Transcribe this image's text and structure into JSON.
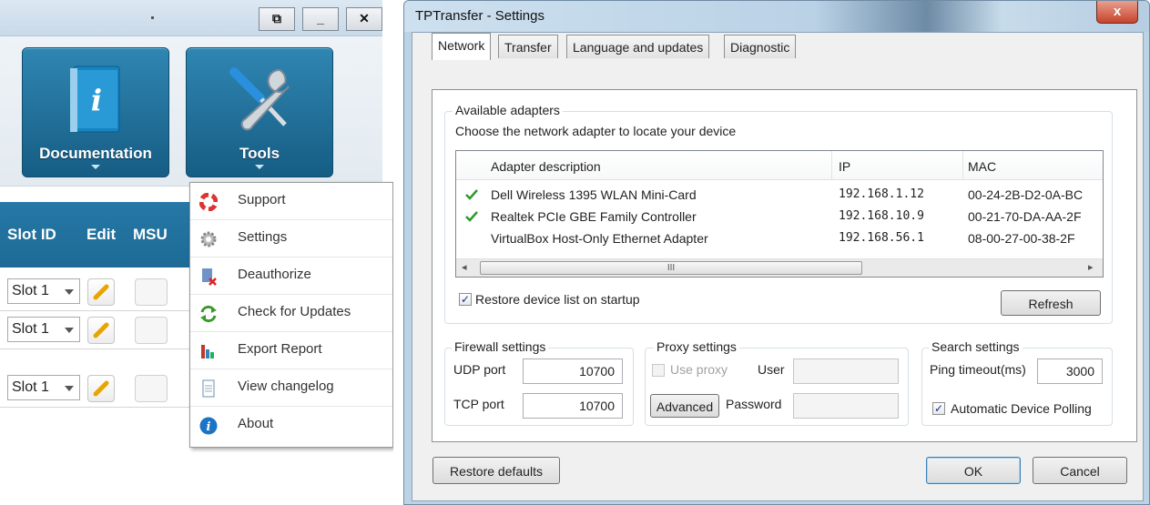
{
  "left_app": {
    "window_buttons": [
      "⧉",
      "_",
      "✕"
    ],
    "ribbon": [
      {
        "label": "Documentation",
        "icon": "book-info-icon"
      },
      {
        "label": "Tools",
        "icon": "screwdriver-wrench-icon"
      }
    ],
    "grid_headers": [
      "Slot ID",
      "Edit",
      "MSU"
    ],
    "rows": [
      {
        "slot": "Slot 1"
      },
      {
        "slot": "Slot 1"
      },
      {
        "slot": "Slot 1"
      }
    ]
  },
  "tools_menu": {
    "items": [
      {
        "label": "Support",
        "icon": "lifebuoy-icon"
      },
      {
        "label": "Settings",
        "icon": "gear-icon"
      },
      {
        "label": "Deauthorize",
        "icon": "deauthorize-icon"
      },
      {
        "label": "Check for Updates",
        "icon": "refresh-icon"
      },
      {
        "label": "Export Report",
        "icon": "bar-chart-icon"
      },
      {
        "label": "View changelog",
        "icon": "document-icon"
      },
      {
        "label": "About",
        "icon": "info-icon"
      }
    ]
  },
  "dialog": {
    "title": "TPTransfer - Settings",
    "close_glyph": "x",
    "tabs": [
      "Network",
      "Transfer",
      "Language and updates",
      "Diagnostic"
    ],
    "active_tab": "Network",
    "adapters": {
      "group_label": "Available adapters",
      "instruction": "Choose the network adapter to locate your device",
      "columns": [
        "Adapter description",
        "IP",
        "MAC"
      ],
      "rows": [
        {
          "checked": true,
          "description": "Dell Wireless 1395 WLAN Mini-Card",
          "ip": "192.168.1.12",
          "mac": "00-24-2B-D2-0A-BC"
        },
        {
          "checked": true,
          "description": "Realtek PCIe GBE Family Controller",
          "ip": "192.168.10.9",
          "mac": "00-21-70-DA-AA-2F"
        },
        {
          "checked": false,
          "description": "VirtualBox Host-Only Ethernet Adapter",
          "ip": "192.168.56.1",
          "mac": "08-00-27-00-38-2F"
        }
      ],
      "restore_label": "Restore device list on startup",
      "restore_checked": true,
      "refresh_label": "Refresh",
      "scroll_thumb_glyph": "III"
    },
    "firewall": {
      "group_label": "Firewall settings",
      "udp_label": "UDP port",
      "udp_value": "10700",
      "tcp_label": "TCP port",
      "tcp_value": "10700"
    },
    "proxy": {
      "group_label": "Proxy settings",
      "use_proxy_label": "Use proxy",
      "use_proxy_checked": false,
      "user_label": "User",
      "user_value": "",
      "advanced_label": "Advanced",
      "password_label": "Password",
      "password_value": ""
    },
    "search": {
      "group_label": "Search settings",
      "ping_label": "Ping timeout(ms)",
      "ping_value": "3000",
      "auto_polling_label": "Automatic Device Polling",
      "auto_polling_checked": true
    },
    "buttons": {
      "restore_defaults": "Restore defaults",
      "ok": "OK",
      "cancel": "Cancel"
    }
  }
}
